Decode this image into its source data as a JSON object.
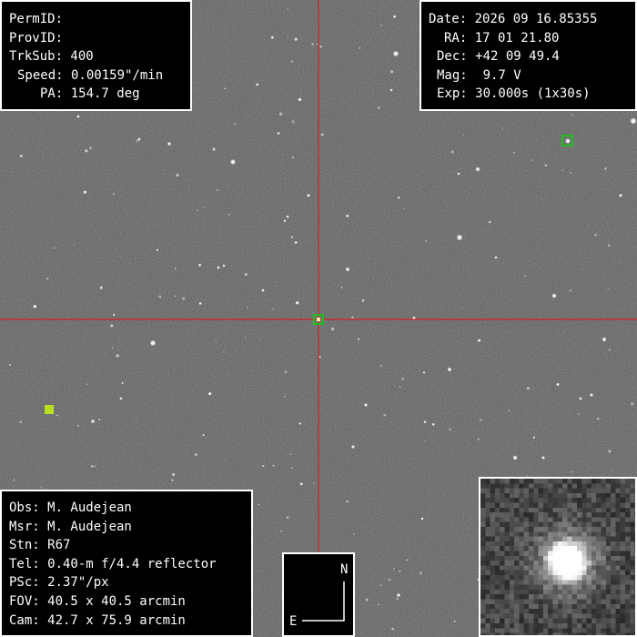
{
  "target_info": {
    "permid_label": "PermID:",
    "provid_label": "ProvID:",
    "trksub": "TrkSub: 400",
    "speed": "Speed: 0.00159\"/min",
    "pa": "PA: 154.7 deg"
  },
  "observation_info": {
    "date": "Date: 2026 09 16.85355",
    "ra": "RA: 17 01 21.80",
    "dec": "Dec: +42 09 49.4",
    "mag": "Mag:  9.7 V",
    "exp": "Exp: 30.000s (1x30s)"
  },
  "station_info": {
    "obs": "Obs: M. Audejean",
    "msr": "Msr: M. Audejean",
    "stn": "Stn: R67",
    "tel": "Tel: 0.40-m f/4.4 reflector",
    "psc": "PSc: 2.37\"/px",
    "fov": "FOV: 40.5 x 40.5 arcmin",
    "cam": "Cam: 42.7 x 75.9 arcmin"
  },
  "compass": {
    "north": "N",
    "east": "E"
  },
  "colors": {
    "crosshair": "#d42020",
    "target_marker": "#1fbf1f",
    "reference_marker": "#b8e01e",
    "panel_background": "#000000",
    "panel_text": "#ffffff"
  },
  "icons": [
    "crosshair",
    "target-marker",
    "reference-star-marker",
    "compass-rose",
    "target-thumbnail"
  ]
}
